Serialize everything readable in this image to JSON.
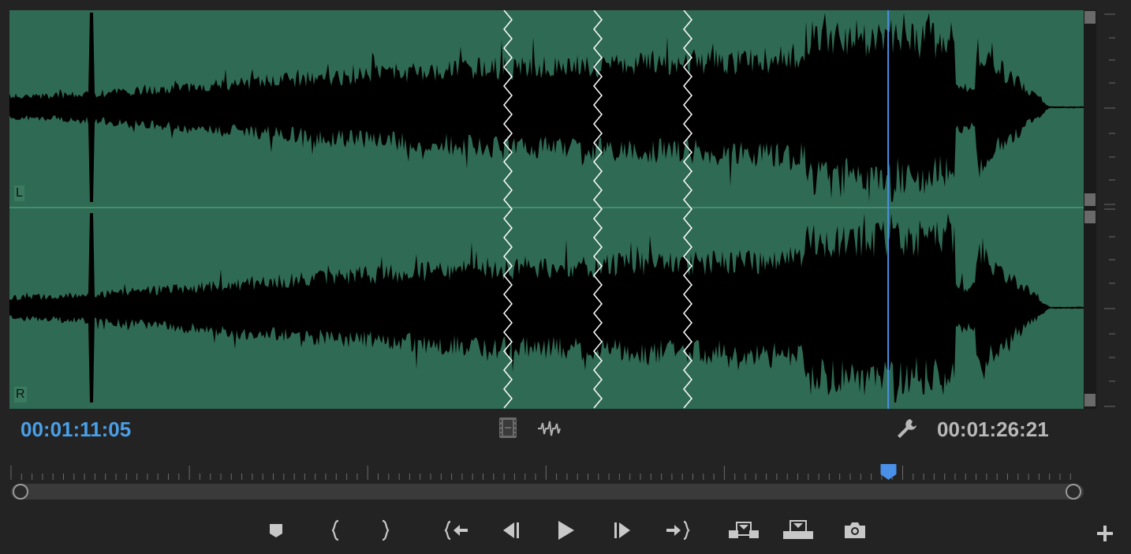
{
  "channels": {
    "left_label": "L",
    "right_label": "R"
  },
  "timecodes": {
    "current": "00:01:11:05",
    "duration": "00:01:26:21"
  },
  "playhead_fraction": 0.818,
  "colors": {
    "waveform_bg": "#2f6b54",
    "waveform_fill": "#000000",
    "playhead": "#4a8fe8",
    "current_time": "#4a9fe8",
    "panel_bg": "#232323"
  },
  "toolbar_icons": [
    "film-strip-icon",
    "audio-waveform-icon",
    "wrench-icon"
  ],
  "transport_controls": [
    "add-marker-icon",
    "mark-in-icon",
    "mark-out-icon",
    "go-to-in-icon",
    "step-back-icon",
    "play-icon",
    "step-forward-icon",
    "go-to-out-icon",
    "insert-icon",
    "overwrite-icon",
    "export-frame-icon",
    "add-button-icon"
  ]
}
